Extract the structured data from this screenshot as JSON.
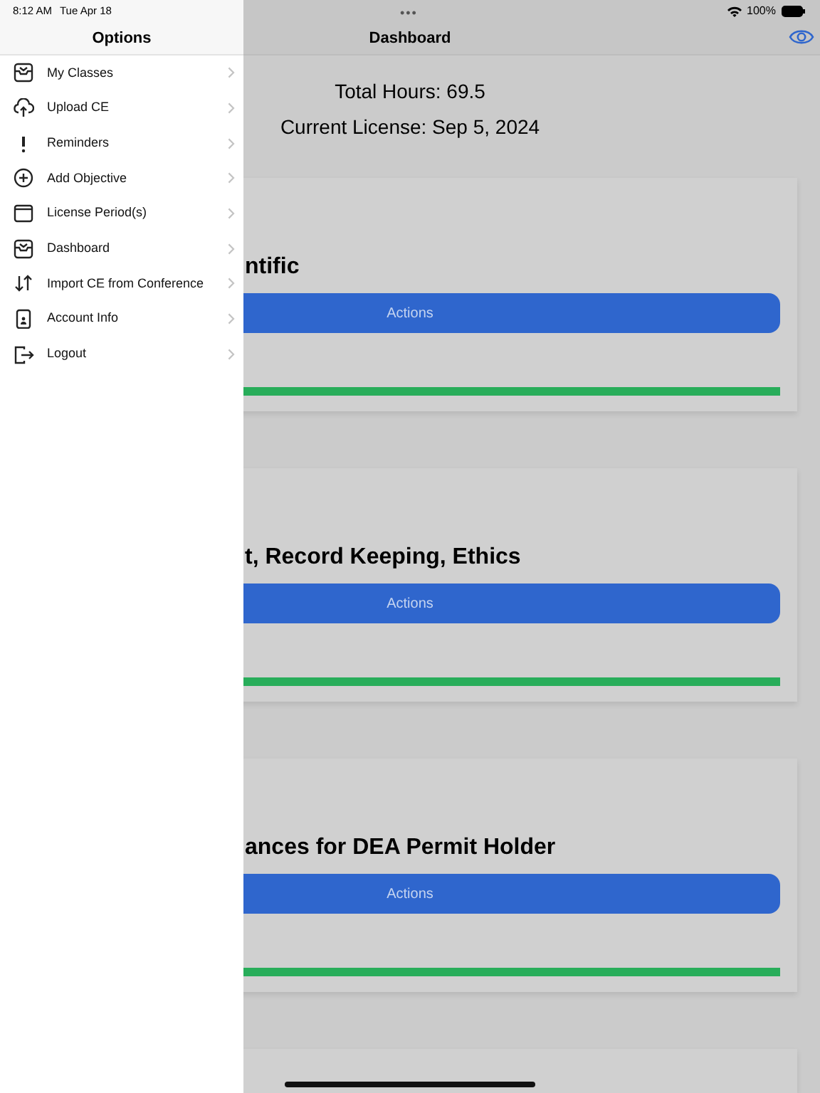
{
  "status_bar": {
    "time": "8:12 AM",
    "date": "Tue Apr 18",
    "battery": "100%",
    "dots": "•••"
  },
  "drawer": {
    "title": "Options",
    "items": [
      {
        "label": "My Classes"
      },
      {
        "label": "Upload CE"
      },
      {
        "label": "Reminders"
      },
      {
        "label": "Add Objective"
      },
      {
        "label": "License Period(s)"
      },
      {
        "label": "Dashboard"
      },
      {
        "label": "Import CE from Conference"
      },
      {
        "label": "Account Info"
      },
      {
        "label": "Logout"
      }
    ]
  },
  "dashboard": {
    "title": "Dashboard",
    "total_hours": "Total Hours: 69.5",
    "current_license": "Current License: Sep 5, 2024",
    "cards": [
      {
        "title": "ntific",
        "button": "Actions",
        "level": 1
      },
      {
        "title": "t, Record Keeping, Ethics",
        "button": "Actions",
        "level": 1
      },
      {
        "title": "ances for DEA Permit Holder",
        "button": "Actions",
        "level": 1
      }
    ]
  }
}
